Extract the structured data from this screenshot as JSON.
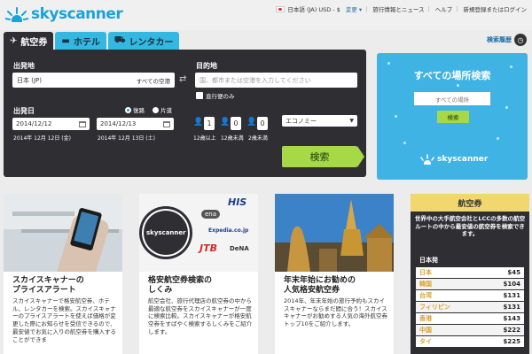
{
  "header": {
    "logo_text": "skyscanner",
    "language": "日本語 (JA) USD - $",
    "change": "変更",
    "travel_info": "旅行情報とニュース",
    "help": "ヘルプ",
    "login": "新規登録またはログイン"
  },
  "tabs": [
    {
      "label": "航空券",
      "icon": "plane-icon"
    },
    {
      "label": "ホテル",
      "icon": "bed-icon"
    },
    {
      "label": "レンタカー",
      "icon": "car-icon"
    }
  ],
  "history_label": "検索履歴",
  "search": {
    "from_label": "出発地",
    "from_value": "日本 (JP)",
    "from_airports": "すべての空港",
    "to_label": "目的地",
    "to_placeholder": "国、都市または空港を入力してください",
    "direct_label": "直行便のみ",
    "depart_label": "出発日",
    "trip_round": "復路",
    "trip_oneway": "片道",
    "depart_date": "2014/12/12",
    "return_date": "2014/12/13",
    "depart_date_long": "2014年 12月 12日 (金)",
    "return_date_long": "2014年 12月 13日 (土)",
    "adults": "1",
    "children": "0",
    "infants": "0",
    "adults_label": "12歳以上",
    "children_label": "12歳未満",
    "infants_label": "2歳未満",
    "cabin": "エコノミー",
    "search_button": "検索"
  },
  "promo": {
    "title": "すべての場所検索",
    "field": "すべての場所",
    "button": "検索",
    "logo": "skyscanner"
  },
  "cards": [
    {
      "title": "スカイスキャナーの\nプライスアラート",
      "text": "スカイスキャナーで格安航空券、ホテル、レンタカーを検索。スカイスキャナーのプライスアラートを使えば価格が変更した際にお知らせを受信できるので、最安値でお気に入りの航空券を購入することができま"
    },
    {
      "title": "格安航空券検索の\nしくみ",
      "text": "航空会社、旅行代理店の航空券の中から最適な航空券をスカイスキャナーが一度に検索比較。スカイスキャナーが格安航空券をすばやく検索するしくみをご紹介します。",
      "logos": [
        "HIS",
        "ena",
        "Expedia.co.jp",
        "JTB",
        "DeNA",
        "skyscanner"
      ]
    },
    {
      "title": "年末年始にお勧めの\n人気格安航空券",
      "text": "2014年、年末年始の旅行予約もスカイスキャナーならまだ間に合う！スカイスキャナーがお勧めする人気の海外航空券トップ10をご紹介します。"
    }
  ],
  "sidebar": {
    "title": "航空券",
    "description": "世界中の大手航空会社とLCCの多数の航空ルートの中から最安値の航空券を検索できます。",
    "section": "日本発",
    "rows": [
      {
        "country": "日本",
        "price": "$45"
      },
      {
        "country": "韓国",
        "price": "$104"
      },
      {
        "country": "台湾",
        "price": "$131"
      },
      {
        "country": "フィリピン",
        "price": "$131"
      },
      {
        "country": "香港",
        "price": "$143"
      },
      {
        "country": "中国",
        "price": "$222"
      },
      {
        "country": "タイ",
        "price": "$225"
      }
    ]
  },
  "colors": {
    "brand": "#1aa3d8",
    "panel": "#2e2e33",
    "search_green": "#a7d946",
    "sidebar_header": "#f2d76f"
  }
}
